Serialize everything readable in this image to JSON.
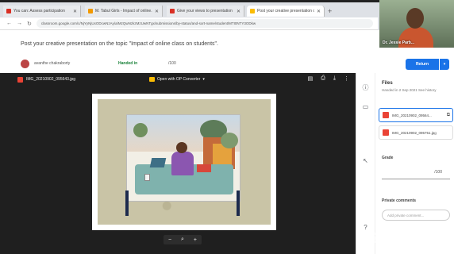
{
  "browser": {
    "tabs": [
      {
        "label": "You can: Assess participation",
        "favicon": "red"
      },
      {
        "label": "M. Tabul Girls - Impact of online...",
        "favicon": "orange"
      },
      {
        "label": "Give your views to presentation",
        "favicon": "red"
      },
      {
        "label": "Post your creative presentation on...",
        "favicon": "yellow"
      }
    ],
    "url": "classroom.google.com/c/NjYyNjUxODcwNzAy/a/MzQwNzkzMzUwNTgx/submissions/by-status/and-sort-name/student/MTI0NTY3ODkw"
  },
  "header": {
    "title": "Post your creative presentation on the topic \"Impact of online class on students\".",
    "student_name": "avanthe chakraborty",
    "status": "Handed in",
    "points": "/100",
    "return_label": "Return",
    "return_caret": "▾"
  },
  "video": {
    "participant_name": "Dr. Jessie Parb..."
  },
  "viewer": {
    "filename": "IMG_20210902_095643.jpg",
    "open_with": "Open with OP Converter",
    "zoom_out": "−",
    "zoom_icon": "⌕",
    "zoom_in": "+"
  },
  "panel": {
    "files_title": "Files",
    "files_sub": "Handed in 2 Sep 2021 See history",
    "files": [
      "IMG_20210902_09564...",
      "IMG_20210902_095751.jpg"
    ],
    "grade_title": "Grade",
    "grade_value": "/100",
    "private_title": "Private comments",
    "private_placeholder": "Add private comment..."
  },
  "watermark": "zoom"
}
